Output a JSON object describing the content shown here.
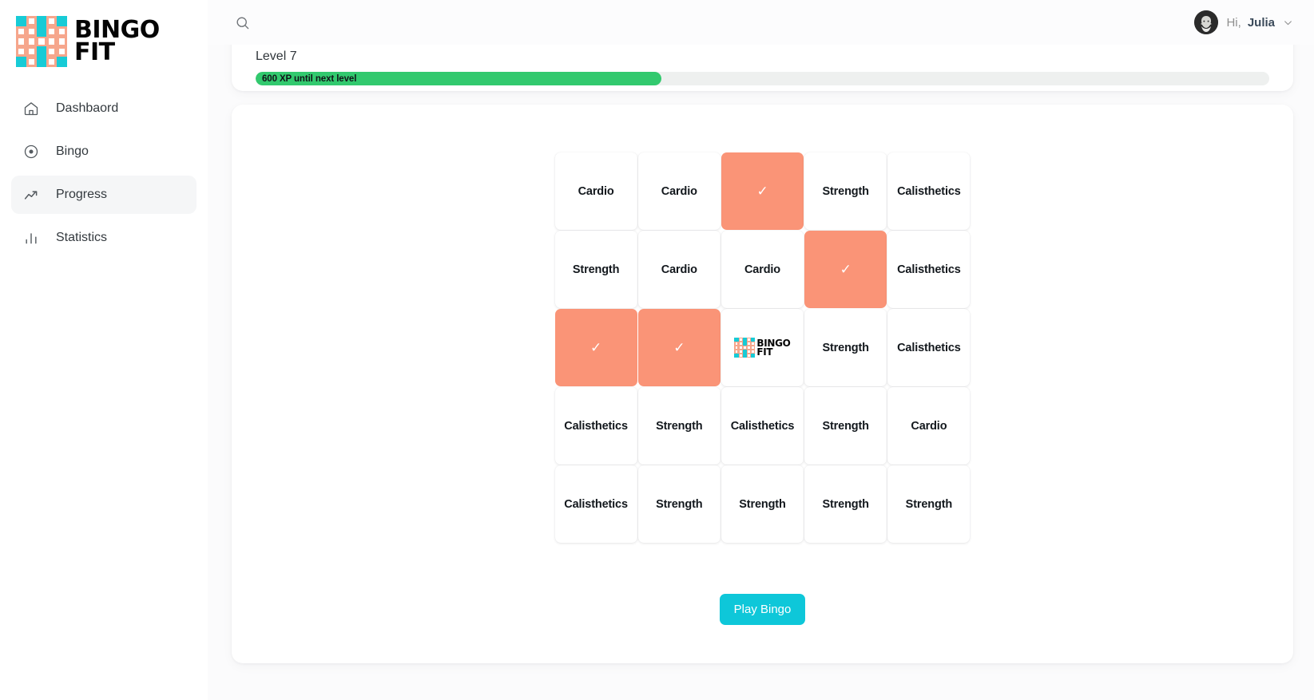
{
  "brand": {
    "line1": "BINGO",
    "line2": "FIT",
    "logo_cyan": "#17CBD6",
    "logo_salmon": "#F6A68C",
    "logo_pattern": [
      [
        "cyan",
        "salmon",
        "cyan",
        "salmon",
        "cyan"
      ],
      [
        "salmon",
        "salmon",
        "cyan",
        "salmon",
        "salmon"
      ],
      [
        "salmon",
        "salmon",
        "salmon",
        "salmon",
        "salmon"
      ],
      [
        "salmon",
        "salmon",
        "cyan",
        "salmon",
        "salmon"
      ],
      [
        "cyan",
        "salmon",
        "cyan",
        "salmon",
        "cyan"
      ]
    ]
  },
  "sidebar": {
    "items": [
      {
        "label": "Dashbaord",
        "icon": "home-icon",
        "active": false
      },
      {
        "label": "Bingo",
        "icon": "target-icon",
        "active": false
      },
      {
        "label": "Progress",
        "icon": "trending-up-icon",
        "active": true
      },
      {
        "label": "Statistics",
        "icon": "bar-chart-icon",
        "active": false
      }
    ]
  },
  "topbar": {
    "search_icon": "search-icon",
    "greeting": "Hi,",
    "username": "Julia",
    "chevron_icon": "chevron-down-icon",
    "avatar": "avatar"
  },
  "level_card": {
    "level_label": "Level 7",
    "xp_text": "600 XP until next level",
    "progress_percent": 40,
    "bar_color": "#32C96E",
    "track_color": "#eef0ef"
  },
  "bingo": {
    "marked_color": "#FA9477",
    "check_glyph": "✓",
    "rows": [
      [
        {
          "label": "Cardio",
          "marked": false,
          "free": false
        },
        {
          "label": "Cardio",
          "marked": false,
          "free": false
        },
        {
          "label": "✓",
          "marked": true,
          "free": false
        },
        {
          "label": "Strength",
          "marked": false,
          "free": false
        },
        {
          "label": "Calisthetics",
          "marked": false,
          "free": false
        }
      ],
      [
        {
          "label": "Strength",
          "marked": false,
          "free": false
        },
        {
          "label": "Cardio",
          "marked": false,
          "free": false
        },
        {
          "label": "Cardio",
          "marked": false,
          "free": false
        },
        {
          "label": "✓",
          "marked": true,
          "free": false
        },
        {
          "label": "Calisthetics",
          "marked": false,
          "free": false
        }
      ],
      [
        {
          "label": "✓",
          "marked": true,
          "free": false
        },
        {
          "label": "✓",
          "marked": true,
          "free": false
        },
        {
          "label": "",
          "marked": false,
          "free": true
        },
        {
          "label": "Strength",
          "marked": false,
          "free": false
        },
        {
          "label": "Calisthetics",
          "marked": false,
          "free": false
        }
      ],
      [
        {
          "label": "Calisthetics",
          "marked": false,
          "free": false
        },
        {
          "label": "Strength",
          "marked": false,
          "free": false
        },
        {
          "label": "Calisthetics",
          "marked": false,
          "free": false
        },
        {
          "label": "Strength",
          "marked": false,
          "free": false
        },
        {
          "label": "Cardio",
          "marked": false,
          "free": false
        }
      ],
      [
        {
          "label": "Calisthetics",
          "marked": false,
          "free": false
        },
        {
          "label": "Strength",
          "marked": false,
          "free": false
        },
        {
          "label": "Strength",
          "marked": false,
          "free": false
        },
        {
          "label": "Strength",
          "marked": false,
          "free": false
        },
        {
          "label": "Strength",
          "marked": false,
          "free": false
        }
      ]
    ],
    "play_button": "Play Bingo",
    "play_button_color": "#0EC7D9"
  }
}
